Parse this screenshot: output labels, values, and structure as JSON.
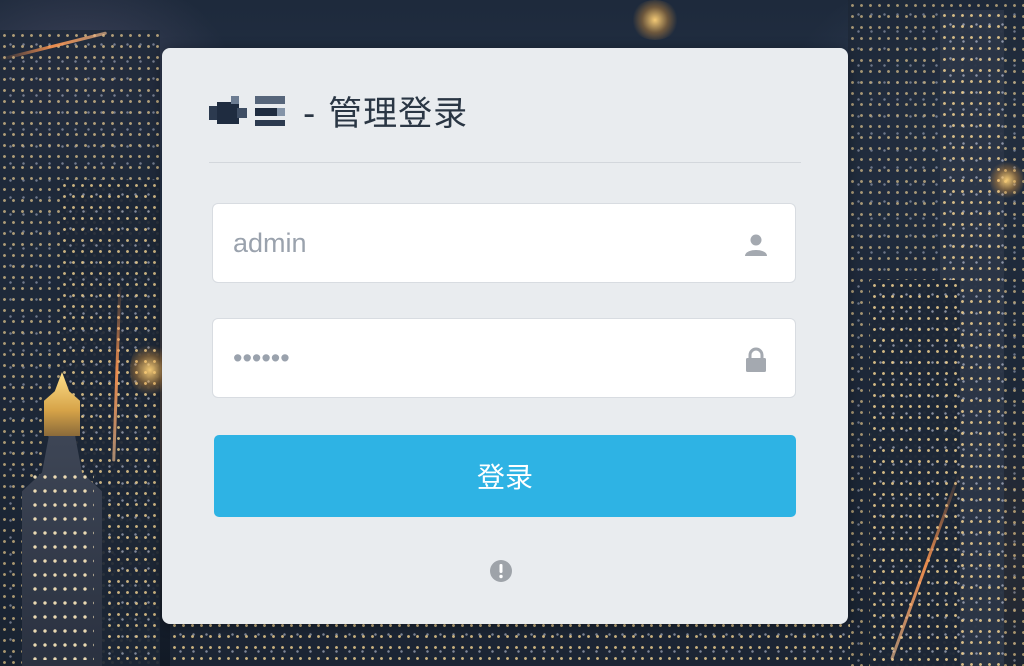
{
  "page": {
    "title": "- 管理登录"
  },
  "login": {
    "username_placeholder": "admin",
    "username_value": "",
    "password_placeholder": "••••••",
    "password_value": "",
    "submit_label": "登录"
  },
  "colors": {
    "accent": "#2eb3e4",
    "card": "#e9ecef",
    "title": "#2a3644"
  },
  "icons": {
    "user": "user-icon",
    "lock": "lock-icon",
    "info": "exclamation-circle-icon"
  }
}
